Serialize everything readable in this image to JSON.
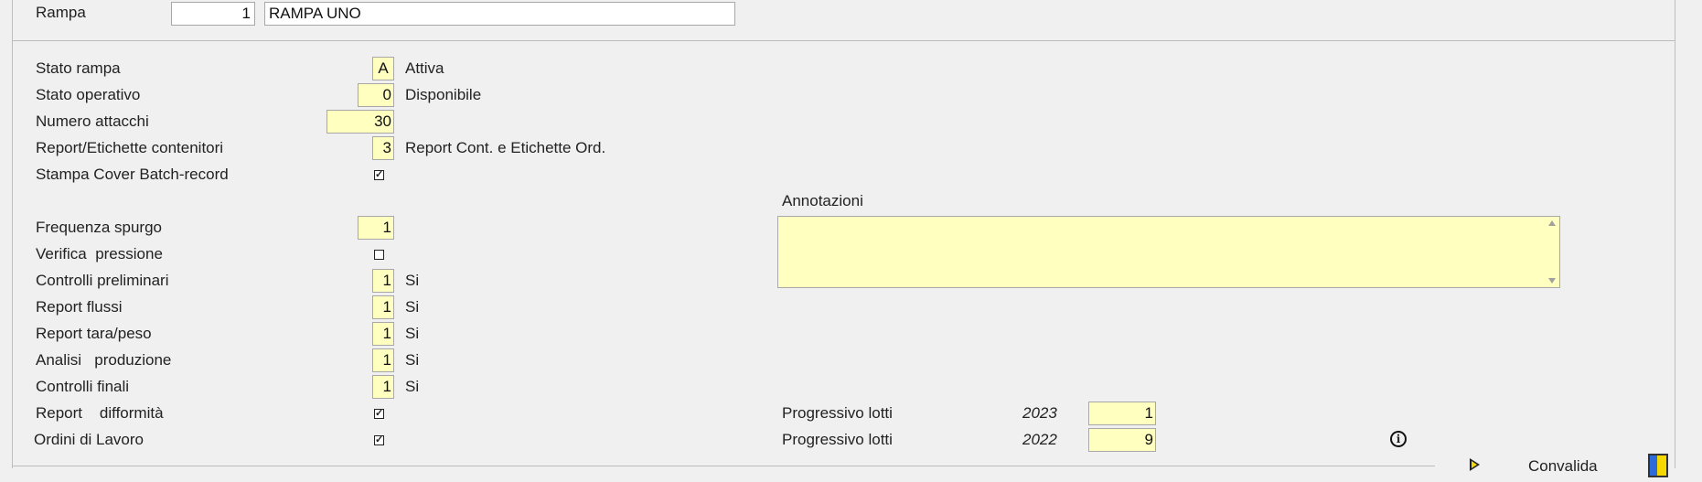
{
  "header": {
    "rampa_label": "Rampa",
    "rampa_code": "1",
    "rampa_name": "RAMPA UNO"
  },
  "form": {
    "stato_rampa": {
      "label": "Stato rampa",
      "value": "A",
      "desc": "Attiva"
    },
    "stato_operativo": {
      "label": "Stato operativo",
      "value": "0",
      "desc": "Disponibile"
    },
    "numero_attacchi": {
      "label": "Numero attacchi",
      "value": "30"
    },
    "report_etichette": {
      "label": "Report/Etichette contenitori",
      "value": "3",
      "desc": "Report Cont. e Etichette Ord."
    },
    "stampa_cover": {
      "label": "Stampa Cover Batch-record",
      "checked": true
    },
    "frequenza_spurgo": {
      "label": "Frequenza spurgo",
      "value": "1"
    },
    "verifica_pressione": {
      "label": "Verifica  pressione",
      "checked": false
    },
    "controlli_preliminari": {
      "label": "Controlli preliminari",
      "value": "1",
      "desc": "Si"
    },
    "report_flussi": {
      "label": "Report flussi",
      "value": "1",
      "desc": "Si"
    },
    "report_tara_peso": {
      "label": "Report tara/peso",
      "value": "1",
      "desc": "Si"
    },
    "analisi_produzione": {
      "label": "Analisi   produzione",
      "value": "1",
      "desc": "Si"
    },
    "controlli_finali": {
      "label": "Controlli finali",
      "value": "1",
      "desc": "Si"
    },
    "report_difformita": {
      "label": "Report    difformità",
      "checked": true
    },
    "ordini_lavoro": {
      "label": "Ordini di Lavoro",
      "checked": true
    }
  },
  "annotazioni": {
    "label": "Annotazioni",
    "value": ""
  },
  "progressivi": [
    {
      "label": "Progressivo lotti",
      "year": "2023",
      "value": "1"
    },
    {
      "label": "Progressivo lotti",
      "year": "2022",
      "value": "9"
    }
  ],
  "footer": {
    "convalida_label": "Convalida",
    "info_icon": "info-icon",
    "play_icon": "play-icon",
    "panel_icon": "panel-icon"
  },
  "colors": {
    "field_bg": "#ffffc0",
    "window_bg": "#f0f0f0"
  }
}
